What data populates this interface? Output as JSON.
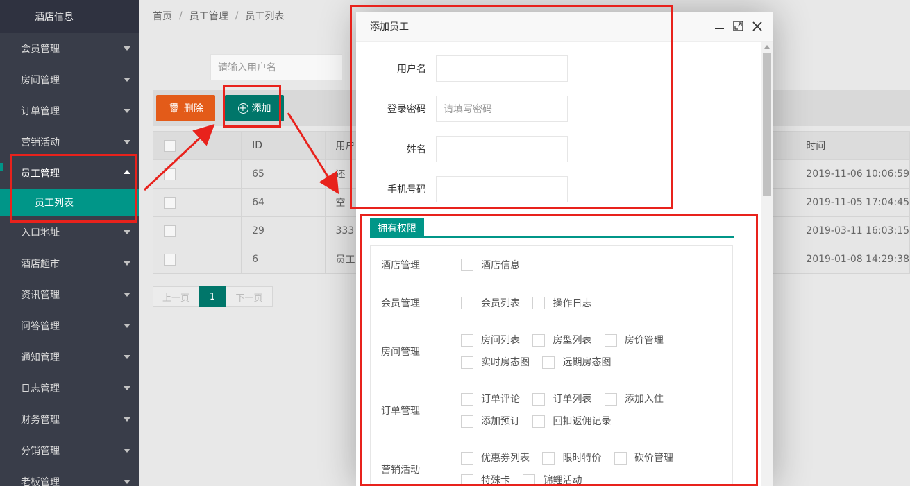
{
  "sidebar": {
    "top": "酒店信息",
    "items": [
      {
        "label": "会员管理"
      },
      {
        "label": "房间管理"
      },
      {
        "label": "订单管理"
      },
      {
        "label": "营销活动"
      },
      {
        "label": "员工管理"
      },
      {
        "label": "入口地址"
      },
      {
        "label": "酒店超市"
      },
      {
        "label": "资讯管理"
      },
      {
        "label": "问答管理"
      },
      {
        "label": "通知管理"
      },
      {
        "label": "日志管理"
      },
      {
        "label": "财务管理"
      },
      {
        "label": "分销管理"
      },
      {
        "label": "老板管理"
      }
    ],
    "sub_active": "员工列表"
  },
  "breadcrumb": [
    "首页",
    "员工管理",
    "员工列表"
  ],
  "search": {
    "placeholder": "请输入用户名"
  },
  "toolbar": {
    "delete_label": "删除",
    "add_label": "添加"
  },
  "table": {
    "headers": {
      "id": "ID",
      "user": "用户",
      "time": "时间"
    },
    "rows": [
      {
        "id": "65",
        "user": "还",
        "time": "2019-11-06 10:06:59"
      },
      {
        "id": "64",
        "user": "空",
        "time": "2019-11-05 17:04:45"
      },
      {
        "id": "29",
        "user": "333",
        "time": "2019-03-11 16:03:15"
      },
      {
        "id": "6",
        "user": "员工",
        "time": "2019-01-08 14:29:38"
      }
    ]
  },
  "pager": {
    "prev": "上一页",
    "current": "1",
    "next": "下一页"
  },
  "modal": {
    "title": "添加员工",
    "fields": {
      "username_label": "用户名",
      "password_label": "登录密码",
      "password_placeholder": "请填写密码",
      "name_label": "姓名",
      "phone_label": "手机号码"
    },
    "perm_tab": "拥有权限",
    "permissions": [
      {
        "module": "酒店管理",
        "lines": [
          [
            "酒店信息"
          ]
        ]
      },
      {
        "module": "会员管理",
        "lines": [
          [
            "会员列表",
            "操作日志"
          ]
        ]
      },
      {
        "module": "房间管理",
        "lines": [
          [
            "房间列表",
            "房型列表",
            "房价管理"
          ],
          [
            "实时房态图",
            "远期房态图"
          ]
        ]
      },
      {
        "module": "订单管理",
        "lines": [
          [
            "订单评论",
            "订单列表",
            "添加入住"
          ],
          [
            "添加预订",
            "回扣返佣记录"
          ]
        ]
      },
      {
        "module": "营销活动",
        "lines": [
          [
            "优惠券列表",
            "限时特价",
            "砍价管理"
          ],
          [
            "特殊卡",
            "锦鲤活动"
          ]
        ]
      }
    ]
  },
  "colors": {
    "accent": "#009688",
    "danger": "#e35b19",
    "annotation": "#e8221c"
  }
}
